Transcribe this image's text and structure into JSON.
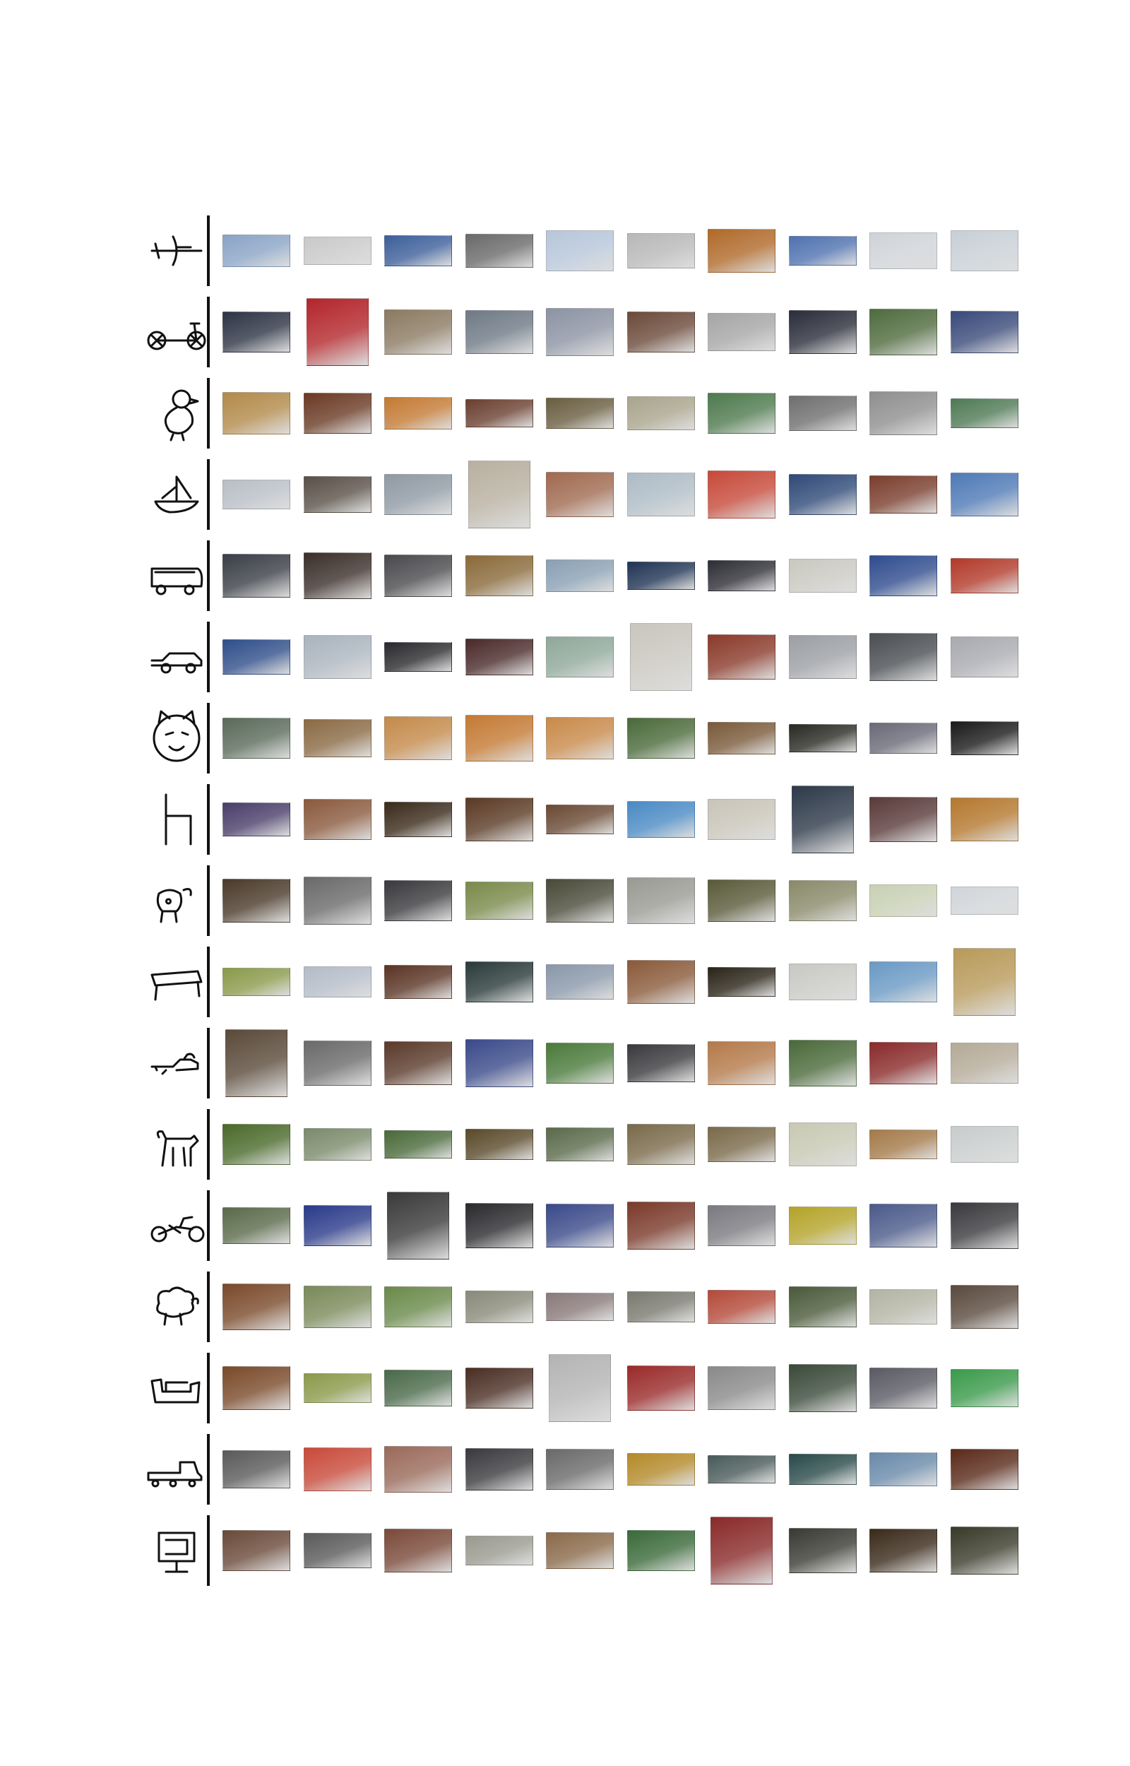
{
  "figure": {
    "description_free": true,
    "columns_per_row": 10,
    "rows": [
      {
        "sketch_icon": "airplane-sketch-icon",
        "photos": [
          "#8aa4c6",
          "#c9c9c9",
          "#3d5f9a",
          "#6a6a6a",
          "#b7c6da",
          "#b8b8b8",
          "#b06a2a",
          "#4f72b0",
          "#cfd3d8",
          "#c7cfd6"
        ]
      },
      {
        "sketch_icon": "bicycle-sketch-icon",
        "photos": [
          "#2d3444",
          "#b3262b",
          "#8b7a62",
          "#6f7a86",
          "#8c93a3",
          "#6b4a3a",
          "#a6a6a6",
          "#2a2d3a",
          "#4f6b3e",
          "#3a4a7a"
        ]
      },
      {
        "sketch_icon": "bird-sketch-icon",
        "photos": [
          "#b28a4a",
          "#6a3a24",
          "#c47a34",
          "#6a4030",
          "#6a5e40",
          "#a9a48c",
          "#4e7a4e",
          "#6f6f6f",
          "#8f8f8f",
          "#4f7a55"
        ]
      },
      {
        "sketch_icon": "boat-sketch-icon",
        "photos": [
          "#b9bec6",
          "#5a5048",
          "#8f9aa4",
          "#b8b0a0",
          "#a06a50",
          "#aebcc6",
          "#c64a3a",
          "#2f4a78",
          "#7a3e2e",
          "#4f7ab6"
        ]
      },
      {
        "sketch_icon": "bus-sketch-icon",
        "photos": [
          "#3a3e46",
          "#3b2f2a",
          "#4a4a4e",
          "#8a6a3a",
          "#8aa0b4",
          "#203454",
          "#2e2e36",
          "#c9c8c0",
          "#2f4c8e",
          "#b23a2a"
        ]
      },
      {
        "sketch_icon": "car-sketch-icon",
        "photos": [
          "#2f4e8a",
          "#aab4be",
          "#2a2a2e",
          "#4a2a2a",
          "#8fa89a",
          "#c9c6be",
          "#8a3a2a",
          "#9c9fa4",
          "#4a4e52",
          "#a9aab0"
        ]
      },
      {
        "sketch_icon": "cat-sketch-icon",
        "photos": [
          "#5a6a5a",
          "#8a6a44",
          "#c48a4a",
          "#c47a34",
          "#c88a4a",
          "#4a6a3a",
          "#7a5a3a",
          "#2a2a24",
          "#6a6a78",
          "#1a1a1a"
        ]
      },
      {
        "sketch_icon": "chair-sketch-icon",
        "photos": [
          "#4a3e6a",
          "#8a5a3e",
          "#3a2a1a",
          "#5a3a24",
          "#6a4a34",
          "#4a8ac4",
          "#c8c4b8",
          "#2e3a4a",
          "#5a3a3a",
          "#b4782e"
        ]
      },
      {
        "sketch_icon": "cow-sketch-icon",
        "photos": [
          "#4a3a2a",
          "#6a6a6a",
          "#3a3a3e",
          "#7a8a4a",
          "#4a4a3a",
          "#9a9a94",
          "#5a5a3a",
          "#8a8a6a",
          "#c8d0b4",
          "#d0d4d8"
        ]
      },
      {
        "sketch_icon": "table-sketch-icon",
        "photos": [
          "#8a9a4a",
          "#b4bcc8",
          "#5a3424",
          "#2a3a3a",
          "#8a98aa",
          "#8a5a3a",
          "#2a2418",
          "#c8c8c4",
          "#6a9ac4",
          "#b89a5a"
        ]
      },
      {
        "sketch_icon": "dog-sketch-icon",
        "photos": [
          "#5a4a3a",
          "#6a6a6a",
          "#5a3a2a",
          "#3a4a8a",
          "#4a7a3a",
          "#3a3a3e",
          "#b47a4a",
          "#4a6a3a",
          "#8a2a2a",
          "#b4aa98"
        ]
      },
      {
        "sketch_icon": "horse-sketch-icon",
        "photos": [
          "#4a6a2a",
          "#7a8a6a",
          "#4a6a3a",
          "#5a4a2a",
          "#5a6a4a",
          "#7a6a4a",
          "#7a6a4a",
          "#c8c8b4",
          "#a47a4a",
          "#c8cccc"
        ]
      },
      {
        "sketch_icon": "motorbike-sketch-icon",
        "photos": [
          "#5a6a4a",
          "#2a3a8a",
          "#3a3a3a",
          "#2a2a2e",
          "#3a4a8a",
          "#7a3a2a",
          "#7a7a80",
          "#b4a42a",
          "#4a5a8a",
          "#3a3a3e"
        ]
      },
      {
        "sketch_icon": "sheep-sketch-icon",
        "photos": [
          "#7a4a2a",
          "#7a8a5a",
          "#6a8a4a",
          "#8a8a7a",
          "#8a7a7a",
          "#7a7a70",
          "#b44a3a",
          "#4a5a3a",
          "#b4b4a4",
          "#5a4a3e"
        ]
      },
      {
        "sketch_icon": "sofa-sketch-icon",
        "photos": [
          "#7a4a2a",
          "#8a9a4a",
          "#4a6a4a",
          "#4a2e24",
          "#b4b4b4",
          "#9a2a2a",
          "#8a8a8a",
          "#3a4a3a",
          "#5a5a64",
          "#3a9a4a"
        ]
      },
      {
        "sketch_icon": "train-sketch-icon",
        "photos": [
          "#5a5a5a",
          "#c84a3a",
          "#9a6a5a",
          "#3a3a3e",
          "#6a6a6a",
          "#b48a2a",
          "#4a5a5a",
          "#2a4a4a",
          "#6a8aaa",
          "#5a2a1a"
        ]
      },
      {
        "sketch_icon": "tvmonitor-sketch-icon",
        "photos": [
          "#6a4a3a",
          "#5a5a5a",
          "#7a4a3a",
          "#9a9a90",
          "#8a6a4a",
          "#3a6a3a",
          "#8a2a2a",
          "#3a3a34",
          "#3a2a1a",
          "#3a3a2a"
        ]
      }
    ]
  }
}
